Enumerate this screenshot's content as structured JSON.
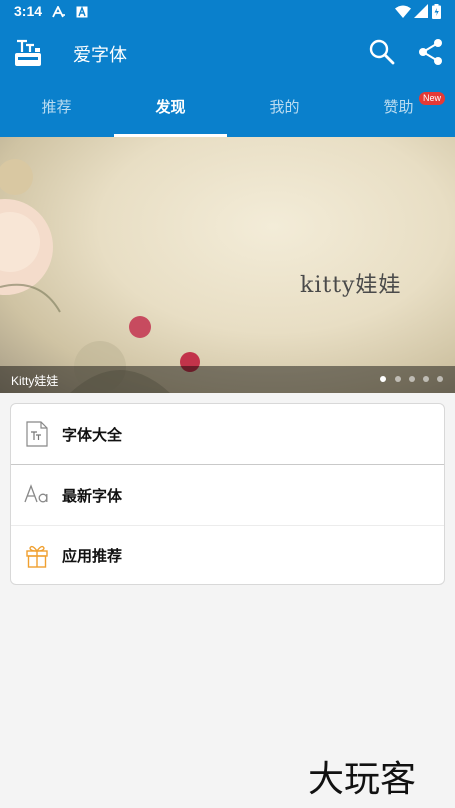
{
  "status_bar": {
    "time": "3:14",
    "icons": [
      "a-icon",
      "a-box-icon",
      "wifi-icon",
      "signal-icon",
      "battery-icon"
    ]
  },
  "app_bar": {
    "title": "爱字体",
    "icons": [
      "app-logo-icon",
      "search-icon",
      "share-icon"
    ]
  },
  "tabs": [
    {
      "label": "推荐",
      "active": false
    },
    {
      "label": "发现",
      "active": true
    },
    {
      "label": "我的",
      "active": false
    },
    {
      "label": "赞助",
      "active": false,
      "badge": "New"
    }
  ],
  "banner": {
    "caption": "Kitty娃娃",
    "art_text": "kitty娃娃",
    "slide_count": 5,
    "active_slide": 1
  },
  "menu": [
    {
      "label": "字体大全",
      "icon": "font-tt-icon"
    },
    {
      "label": "最新字体",
      "icon": "aa-icon"
    },
    {
      "label": "应用推荐",
      "icon": "gift-icon"
    }
  ],
  "watermark": "大玩客",
  "colors": {
    "primary": "#0a80cc",
    "badge": "#e53935",
    "gift": "#f0a030"
  }
}
